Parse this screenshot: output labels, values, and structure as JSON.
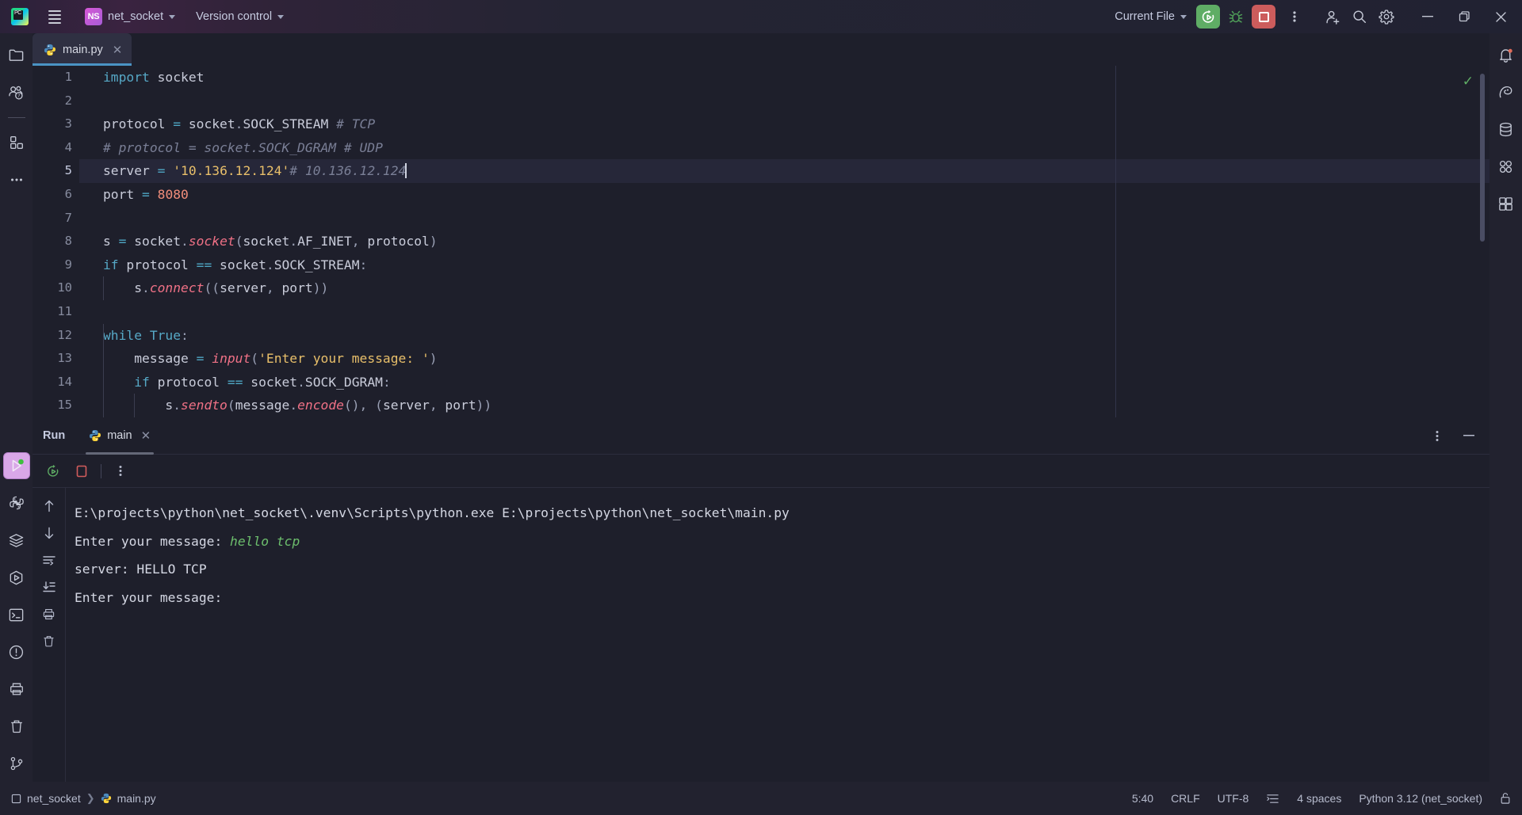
{
  "titlebar": {
    "app_logo": "pycharm-logo",
    "menu_icon": "hamburger-menu-icon",
    "project_badge": "NS",
    "project_name": "net_socket",
    "version_control": "Version control",
    "run_config": "Current File",
    "run_icon": "rerun-icon",
    "debug_icon": "debug-bug-icon",
    "stop_icon": "stop-icon",
    "more_icon": "more-vertical-icon",
    "account_icon": "add-account-icon",
    "search_icon": "search-icon",
    "settings_icon": "settings-gear-icon",
    "minimize_icon": "minimize-icon",
    "maximize_icon": "maximize-icon",
    "close_icon": "close-icon"
  },
  "left_rail": [
    {
      "name": "project",
      "icon": "folder-icon"
    },
    {
      "name": "commit",
      "icon": "commit-people-icon"
    },
    {
      "name": "structure",
      "icon": "squares-icon"
    },
    {
      "name": "more-tool-windows",
      "icon": "ellipsis-icon"
    },
    {
      "name": "run",
      "icon": "run-play-icon"
    },
    {
      "name": "python-console",
      "icon": "python-icon"
    },
    {
      "name": "python-packages",
      "icon": "layers-icon"
    },
    {
      "name": "services",
      "icon": "services-icon"
    },
    {
      "name": "terminal",
      "icon": "terminal-icon"
    },
    {
      "name": "problems",
      "icon": "problems-warning-icon"
    },
    {
      "name": "print",
      "icon": "print-icon"
    },
    {
      "name": "delete",
      "icon": "trash-icon"
    },
    {
      "name": "version-control-branch",
      "icon": "branch-icon"
    }
  ],
  "right_rail": [
    {
      "name": "notifications",
      "icon": "bell-icon"
    },
    {
      "name": "ai-assistant",
      "icon": "ai-assistant-icon"
    },
    {
      "name": "database",
      "icon": "database-icon"
    },
    {
      "name": "plugins",
      "icon": "plugins-icon"
    },
    {
      "name": "learn",
      "icon": "learn-icon"
    }
  ],
  "editor_tab": {
    "filename": "main.py",
    "file_icon": "python-file-icon",
    "close_icon": "close-tab-icon"
  },
  "editor": {
    "inspection_status": "✓",
    "caret_line": 5,
    "lines": [
      {
        "n": "1",
        "tokens": [
          {
            "t": "import",
            "c": "kw"
          },
          {
            "t": " socket",
            "c": "plain"
          }
        ]
      },
      {
        "n": "2",
        "tokens": []
      },
      {
        "n": "3",
        "tokens": [
          {
            "t": "protocol ",
            "c": "plain"
          },
          {
            "t": "=",
            "c": "op"
          },
          {
            "t": " socket",
            "c": "plain"
          },
          {
            "t": ".",
            "c": "punc"
          },
          {
            "t": "SOCK_STREAM ",
            "c": "plain"
          },
          {
            "t": "# TCP",
            "c": "com"
          }
        ]
      },
      {
        "n": "4",
        "tokens": [
          {
            "t": "# protocol = socket.SOCK_DGRAM # UDP",
            "c": "com"
          }
        ]
      },
      {
        "n": "5",
        "tokens": [
          {
            "t": "server ",
            "c": "plain"
          },
          {
            "t": "=",
            "c": "op"
          },
          {
            "t": " ",
            "c": "plain"
          },
          {
            "t": "'10.136.12.124'",
            "c": "str"
          },
          {
            "t": "# 10.136.12.124",
            "c": "com"
          }
        ]
      },
      {
        "n": "6",
        "tokens": [
          {
            "t": "port ",
            "c": "plain"
          },
          {
            "t": "=",
            "c": "op"
          },
          {
            "t": " ",
            "c": "plain"
          },
          {
            "t": "8080",
            "c": "num"
          }
        ]
      },
      {
        "n": "7",
        "tokens": []
      },
      {
        "n": "8",
        "tokens": [
          {
            "t": "s ",
            "c": "plain"
          },
          {
            "t": "=",
            "c": "op"
          },
          {
            "t": " socket",
            "c": "plain"
          },
          {
            "t": ".",
            "c": "punc"
          },
          {
            "t": "socket",
            "c": "fn"
          },
          {
            "t": "(",
            "c": "punc"
          },
          {
            "t": "socket",
            "c": "plain"
          },
          {
            "t": ".",
            "c": "punc"
          },
          {
            "t": "AF_INET",
            "c": "plain"
          },
          {
            "t": ",",
            "c": "punc"
          },
          {
            "t": " protocol",
            "c": "plain"
          },
          {
            "t": ")",
            "c": "punc"
          }
        ]
      },
      {
        "n": "9",
        "tokens": [
          {
            "t": "if",
            "c": "kw"
          },
          {
            "t": " protocol ",
            "c": "plain"
          },
          {
            "t": "==",
            "c": "op"
          },
          {
            "t": " socket",
            "c": "plain"
          },
          {
            "t": ".",
            "c": "punc"
          },
          {
            "t": "SOCK_STREAM",
            "c": "plain"
          },
          {
            "t": ":",
            "c": "punc"
          }
        ]
      },
      {
        "n": "10",
        "tokens": [
          {
            "t": "    s",
            "c": "plain"
          },
          {
            "t": ".",
            "c": "punc"
          },
          {
            "t": "connect",
            "c": "fn"
          },
          {
            "t": "((",
            "c": "punc"
          },
          {
            "t": "server",
            "c": "plain"
          },
          {
            "t": ",",
            "c": "punc"
          },
          {
            "t": " port",
            "c": "plain"
          },
          {
            "t": "))",
            "c": "punc"
          }
        ]
      },
      {
        "n": "11",
        "tokens": []
      },
      {
        "n": "12",
        "tokens": [
          {
            "t": "while",
            "c": "kw"
          },
          {
            "t": " ",
            "c": "plain"
          },
          {
            "t": "True",
            "c": "kw"
          },
          {
            "t": ":",
            "c": "punc"
          }
        ]
      },
      {
        "n": "13",
        "tokens": [
          {
            "t": "    message ",
            "c": "plain"
          },
          {
            "t": "=",
            "c": "op"
          },
          {
            "t": " ",
            "c": "plain"
          },
          {
            "t": "input",
            "c": "fn"
          },
          {
            "t": "(",
            "c": "punc"
          },
          {
            "t": "'Enter your message: '",
            "c": "str"
          },
          {
            "t": ")",
            "c": "punc"
          }
        ]
      },
      {
        "n": "14",
        "tokens": [
          {
            "t": "    ",
            "c": "plain"
          },
          {
            "t": "if",
            "c": "kw"
          },
          {
            "t": " protocol ",
            "c": "plain"
          },
          {
            "t": "==",
            "c": "op"
          },
          {
            "t": " socket",
            "c": "plain"
          },
          {
            "t": ".",
            "c": "punc"
          },
          {
            "t": "SOCK_DGRAM",
            "c": "plain"
          },
          {
            "t": ":",
            "c": "punc"
          }
        ]
      },
      {
        "n": "15",
        "tokens": [
          {
            "t": "        s",
            "c": "plain"
          },
          {
            "t": ".",
            "c": "punc"
          },
          {
            "t": "sendto",
            "c": "fn"
          },
          {
            "t": "(",
            "c": "punc"
          },
          {
            "t": "message",
            "c": "plain"
          },
          {
            "t": ".",
            "c": "punc"
          },
          {
            "t": "encode",
            "c": "fn"
          },
          {
            "t": "(),",
            "c": "punc"
          },
          {
            "t": " (",
            "c": "punc"
          },
          {
            "t": "server",
            "c": "plain"
          },
          {
            "t": ",",
            "c": "punc"
          },
          {
            "t": " port",
            "c": "plain"
          },
          {
            "t": "))",
            "c": "punc"
          }
        ]
      }
    ]
  },
  "run_window": {
    "title": "Run",
    "tab_label": "main",
    "tab_icon": "python-file-icon",
    "tab_close_icon": "close-tab-icon",
    "options_icon": "more-vertical-icon",
    "minimize_icon": "minimize-panel-icon",
    "toolbar": [
      {
        "name": "rerun",
        "icon": "rerun-icon"
      },
      {
        "name": "stop",
        "icon": "stop-icon"
      },
      {
        "name": "more",
        "icon": "more-vertical-icon"
      }
    ],
    "console_rail": [
      {
        "name": "scroll-up",
        "icon": "arrow-up-icon"
      },
      {
        "name": "scroll-down",
        "icon": "arrow-down-icon"
      },
      {
        "name": "soft-wrap",
        "icon": "soft-wrap-icon"
      },
      {
        "name": "scroll-to-end",
        "icon": "scroll-to-end-icon"
      },
      {
        "name": "print",
        "icon": "print-icon"
      },
      {
        "name": "clear-all",
        "icon": "trash-icon"
      }
    ],
    "console_lines": [
      {
        "segments": [
          {
            "text": "E:\\projects\\python\\net_socket\\.venv\\Scripts\\python.exe E:\\projects\\python\\net_socket\\main.py",
            "kind": "out"
          }
        ]
      },
      {
        "segments": [
          {
            "text": "Enter your message: ",
            "kind": "out"
          },
          {
            "text": "hello tcp",
            "kind": "in"
          }
        ]
      },
      {
        "segments": [
          {
            "text": "server: HELLO TCP",
            "kind": "out"
          }
        ]
      },
      {
        "segments": [
          {
            "text": "Enter your message:",
            "kind": "out"
          }
        ]
      }
    ]
  },
  "statusbar": {
    "project_icon": "project-icon",
    "project": "net_socket",
    "file_icon": "python-file-icon",
    "file": "main.py",
    "caret_position": "5:40",
    "line_separator": "CRLF",
    "encoding": "UTF-8",
    "indent_icon": "indent-icon",
    "indent": "4 spaces",
    "interpreter": "Python 3.12 (net_socket)",
    "lock_icon": "unlocked-icon"
  },
  "colors": {
    "accent_blue": "#4a93c4",
    "run_green": "#5fad65",
    "stop_red": "#cc5c5c",
    "keyword": "#56a8c6",
    "string": "#e8bf6a",
    "number": "#f08d7a",
    "comment": "#7a7f96",
    "function": "#f07186",
    "console_input": "#6dbf6d",
    "bg": "#1e1f2b",
    "rail_bg": "#22222f"
  }
}
